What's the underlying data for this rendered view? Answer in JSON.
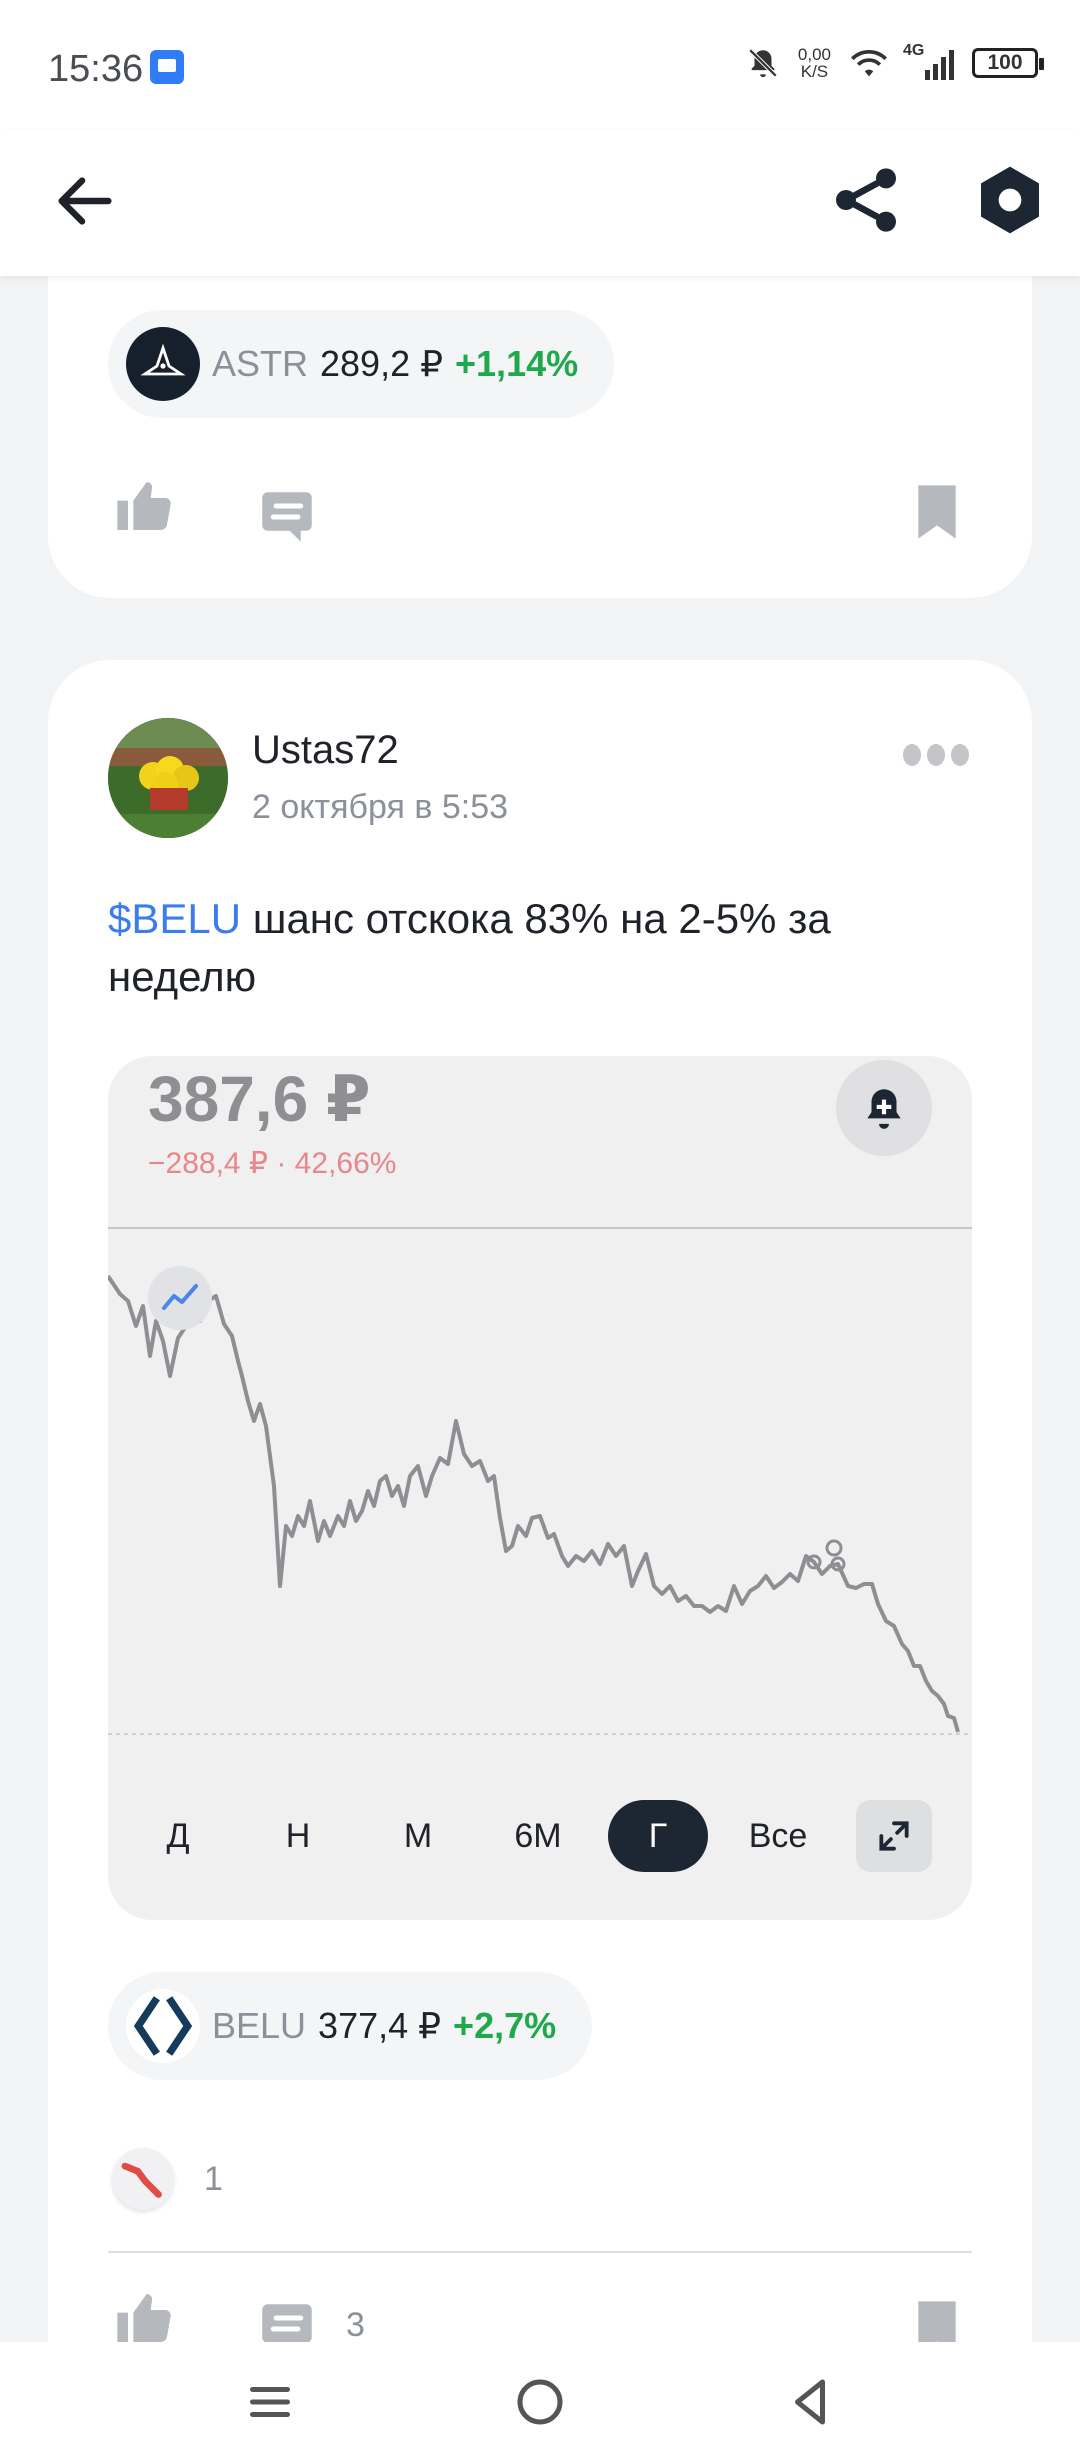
{
  "status_bar": {
    "time": "15:36",
    "net_speed_value": "0,00",
    "net_speed_unit": "K/S",
    "network": "4G",
    "battery": "100"
  },
  "app_bar": {
    "back_icon": "arrow-left-icon",
    "share_icon": "share-icon",
    "settings_icon": "hexagon-icon"
  },
  "prev_post": {
    "ticker": {
      "name": "ASTR",
      "price": "289,2 ₽",
      "change": "+1,14%"
    }
  },
  "post": {
    "author": "Ustas72",
    "date": "2 октября в 5:53",
    "text_tag": "$BELU",
    "text_rest": " шанс отскока 83% на 2-5% за неделю",
    "chart": {
      "price": "387,6 ₽",
      "delta": "−288,4 ₽ · 42,66%",
      "ranges": [
        "Д",
        "Н",
        "М",
        "6М",
        "Г",
        "Все"
      ],
      "active_range": "Г"
    },
    "ticker": {
      "name": "BELU",
      "price": "377,4 ₽",
      "change": "+2,7%"
    },
    "reaction_count": "1",
    "comments_count": "3"
  },
  "colors": {
    "accent": "#3b7ded",
    "positive": "#1fa94a",
    "negative": "#e8878a",
    "chart_line": "#8e8e93"
  }
}
